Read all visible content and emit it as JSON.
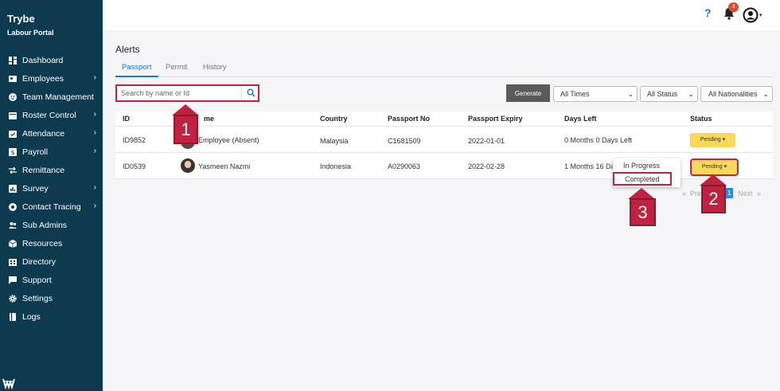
{
  "sidebar": {
    "brand": "Trybe",
    "subtitle": "Labour Portal",
    "items": [
      {
        "label": "Dashboard",
        "icon": "dashboard-icon",
        "chevron": false
      },
      {
        "label": "Employees",
        "icon": "employees-icon",
        "chevron": true
      },
      {
        "label": "Team Management",
        "icon": "team-icon",
        "chevron": false
      },
      {
        "label": "Roster Control",
        "icon": "roster-icon",
        "chevron": true
      },
      {
        "label": "Attendance",
        "icon": "attendance-icon",
        "chevron": true
      },
      {
        "label": "Payroll",
        "icon": "payroll-icon",
        "chevron": true
      },
      {
        "label": "Remittance",
        "icon": "remittance-icon",
        "chevron": false
      },
      {
        "label": "Survey",
        "icon": "survey-icon",
        "chevron": true
      },
      {
        "label": "Contact Tracing",
        "icon": "contact-tracing-icon",
        "chevron": true
      },
      {
        "label": "Sub Admins",
        "icon": "sub-admins-icon",
        "chevron": false
      },
      {
        "label": "Resources",
        "icon": "resources-icon",
        "chevron": false
      },
      {
        "label": "Directory",
        "icon": "directory-icon",
        "chevron": false
      },
      {
        "label": "Support",
        "icon": "support-icon",
        "chevron": false
      },
      {
        "label": "Settings",
        "icon": "settings-icon",
        "chevron": false
      },
      {
        "label": "Logs",
        "icon": "logs-icon",
        "chevron": false
      }
    ]
  },
  "topbar": {
    "help": "?",
    "notification_count": "3"
  },
  "page": {
    "title": "Alerts",
    "tabs": [
      "Passport",
      "Permit",
      "History"
    ],
    "active_tab": "Passport"
  },
  "toolbar": {
    "search_placeholder": "Search by name or Id",
    "generate_label": "Generate",
    "filters": [
      "All Times",
      "All Status",
      "All Nationalities"
    ]
  },
  "table": {
    "columns": [
      "ID",
      "me",
      "Country",
      "Passport No",
      "Passport Expiry",
      "Days Left",
      "Status"
    ],
    "rows": [
      {
        "id": "ID9852",
        "name": "Employee (Absent)",
        "country": "Malaysia",
        "passport": "C1681509",
        "expiry": "2022-01-01",
        "days_left": "0 Months 0 Days Left",
        "status": "Pending"
      },
      {
        "id": "ID0539",
        "name": "Yasmeen Nazmi",
        "country": "Indonesia",
        "passport": "A0290063",
        "expiry": "2022-02-28",
        "days_left": "1 Months 16 Da",
        "status": "Pending"
      }
    ]
  },
  "status_dropdown": {
    "options": [
      "In Progress",
      "Completed"
    ]
  },
  "pagination": {
    "prev_symbol": "«",
    "prev_label": "Pre",
    "current": "1",
    "next_label": "Next",
    "next_symbol": "»"
  },
  "callouts": [
    "1",
    "2",
    "3"
  ],
  "colors": {
    "sidebar_bg": "#0d3a4f",
    "accent_blue": "#1a77c9",
    "status_yellow": "#f9d85a",
    "callout_red": "#c0223f",
    "generate_gray": "#5a5a5a"
  }
}
